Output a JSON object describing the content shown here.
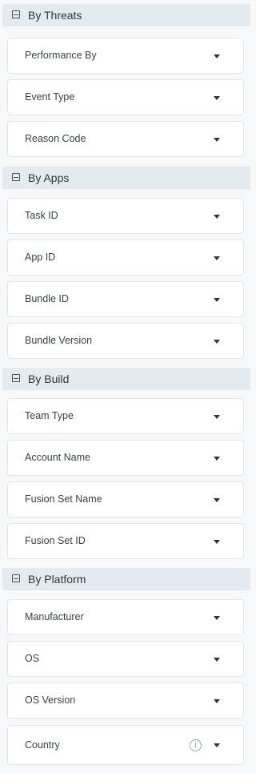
{
  "groups": [
    {
      "title": "By Threats",
      "icon": "collapse-icon",
      "fields": [
        {
          "label": "Performance By"
        },
        {
          "label": "Event Type"
        },
        {
          "label": "Reason Code"
        }
      ]
    },
    {
      "title": "By Apps",
      "icon": "collapse-icon",
      "fields": [
        {
          "label": "Task ID"
        },
        {
          "label": "App ID"
        },
        {
          "label": "Bundle ID"
        },
        {
          "label": "Bundle Version"
        }
      ]
    },
    {
      "title": "By Build",
      "icon": "collapse-icon",
      "fields": [
        {
          "label": "Team Type"
        },
        {
          "label": "Account Name"
        },
        {
          "label": "Fusion Set Name"
        },
        {
          "label": "Fusion Set ID"
        }
      ]
    },
    {
      "title": "By Platform",
      "icon": "collapse-icon",
      "fields": [
        {
          "label": "Manufacturer"
        },
        {
          "label": "OS"
        },
        {
          "label": "OS Version"
        },
        {
          "label": "Country",
          "info_icon": "info-icon",
          "info_glyph": "i"
        }
      ]
    }
  ],
  "icons": {
    "dropdown": "caret-down-icon"
  },
  "colors": {
    "group_header_bg": "#e3ebf1",
    "page_bg": "#f7f8fa",
    "field_bg": "#ffffff"
  }
}
